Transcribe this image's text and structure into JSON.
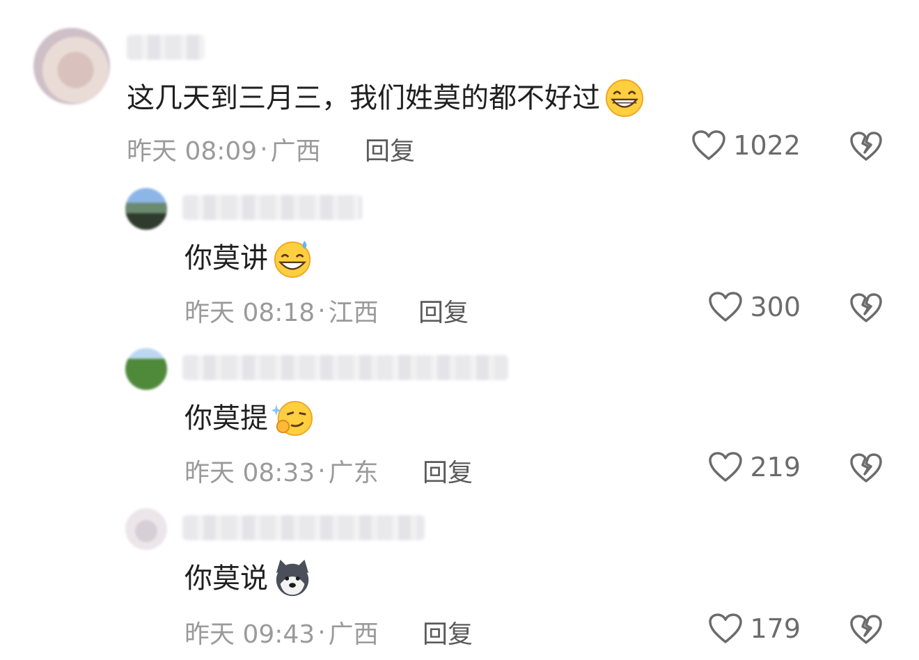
{
  "colors": {
    "meta": "#9a9a9a",
    "reply": "#5a5a5a",
    "icon": "#6b6b6b",
    "text": "#1f1f1f"
  },
  "comments": [
    {
      "text": "这几天到三月三，我们姓莫的都不好过",
      "emoji": "grinning-face-emoji",
      "time": "昨天 08:09",
      "location": "广西",
      "reply_label": "回复",
      "likes": "1022"
    },
    {
      "text": "你莫讲",
      "emoji": "grinning-sweat-face-emoji",
      "time": "昨天 08:18",
      "location": "江西",
      "reply_label": "回复",
      "likes": "300"
    },
    {
      "text": "你莫提",
      "emoji": "smirk-thinking-face-emoji",
      "time": "昨天 08:33",
      "location": "广东",
      "reply_label": "回复",
      "likes": "219"
    },
    {
      "text": "你莫说",
      "emoji": "husky-dog-emoji",
      "time": "昨天 09:43",
      "location": "广西",
      "reply_label": "回复",
      "likes": "179"
    }
  ],
  "separator": "·",
  "icons": {
    "like": "heart-outline-icon",
    "dislike": "broken-heart-icon"
  }
}
